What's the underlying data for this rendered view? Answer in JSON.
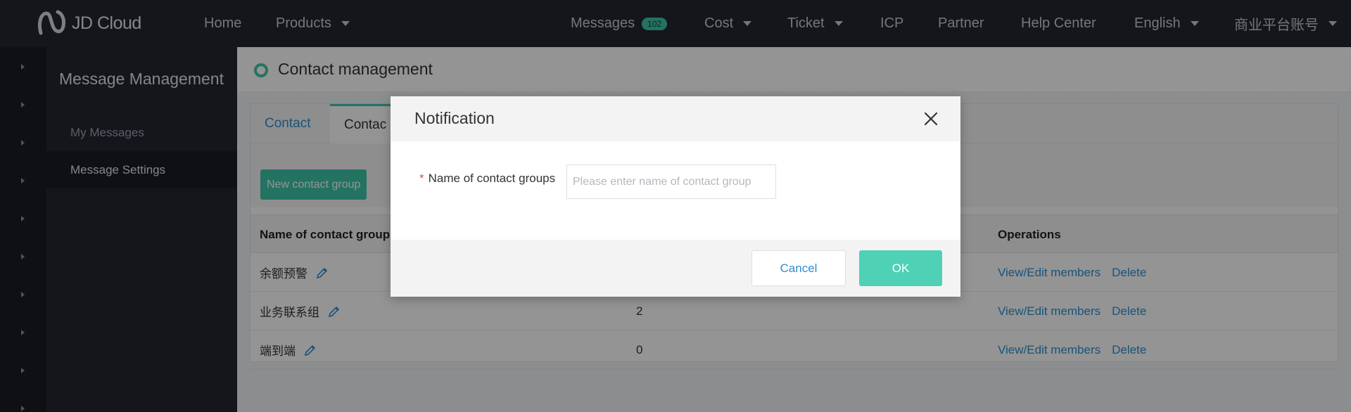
{
  "brand": {
    "name": "JD Cloud",
    "accent": "#3fc6a9",
    "link_color": "#2c8fd3"
  },
  "topnav": {
    "home": "Home",
    "products": "Products",
    "messages": "Messages",
    "messages_count": "102",
    "cost": "Cost",
    "ticket": "Ticket",
    "icp": "ICP",
    "partner": "Partner",
    "help_center": "Help Center",
    "language": "English",
    "account": "商业平台账号"
  },
  "sidebar": {
    "title": "Message Management",
    "items": [
      {
        "label": "My Messages",
        "active": false
      },
      {
        "label": "Message Settings",
        "active": true
      }
    ]
  },
  "page": {
    "title": "Contact management",
    "tabs": [
      {
        "label": "Contact",
        "active": false
      },
      {
        "label": "Contac",
        "active": true
      }
    ],
    "new_group_button": "New contact group",
    "table": {
      "headers": {
        "name": "Name of contact group",
        "operations": "Operations"
      },
      "rows": [
        {
          "name": "余额预警",
          "count": "",
          "view": "View/Edit members",
          "delete": "Delete"
        },
        {
          "name": "业务联系组",
          "count": "2",
          "view": "View/Edit members",
          "delete": "Delete"
        },
        {
          "name": "端到端",
          "count": "0",
          "view": "View/Edit members",
          "delete": "Delete"
        }
      ]
    }
  },
  "modal": {
    "title": "Notification",
    "field_required_mark": "*",
    "field_label": "Name of contact groups",
    "field_value": "",
    "field_placeholder": "Please enter name of contact group",
    "cancel": "Cancel",
    "ok": "OK"
  }
}
